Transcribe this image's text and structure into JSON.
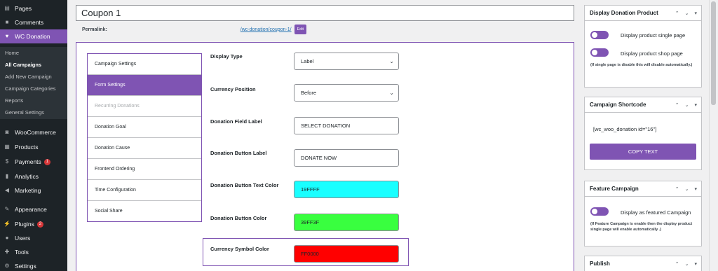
{
  "sidebar": {
    "items": [
      {
        "label": "Pages",
        "icon": "pages-icon"
      },
      {
        "label": "Comments",
        "icon": "comments-icon"
      },
      {
        "label": "WC Donation",
        "icon": "heart-icon"
      },
      {
        "label": "WooCommerce",
        "icon": "woocommerce-icon"
      },
      {
        "label": "Products",
        "icon": "products-icon"
      },
      {
        "label": "Payments",
        "icon": "payments-icon",
        "badge": "1"
      },
      {
        "label": "Analytics",
        "icon": "analytics-icon"
      },
      {
        "label": "Marketing",
        "icon": "marketing-icon"
      },
      {
        "label": "Appearance",
        "icon": "appearance-icon"
      },
      {
        "label": "Plugins",
        "icon": "plugins-icon",
        "badge": "2"
      },
      {
        "label": "Users",
        "icon": "users-icon"
      },
      {
        "label": "Tools",
        "icon": "tools-icon"
      },
      {
        "label": "Settings",
        "icon": "settings-icon"
      }
    ],
    "submenu": [
      "Home",
      "All Campaigns",
      "Add New Campaign",
      "Campaign Categories",
      "Reports",
      "General Settings"
    ]
  },
  "post": {
    "title": "Coupon 1",
    "permalink_label": "Permalink:",
    "permalink_slug_prefix": "/wc-donation/",
    "permalink_slug": "coupon-1",
    "permalink_slug_suffix": "/",
    "edit_label": "Edit"
  },
  "tabs": [
    "Campaign Settings",
    "Form Settings",
    "Recurring Donations",
    "Donation Goal",
    "Donation Cause",
    "Frontend Ordering",
    "Time Configuration",
    "Social Share"
  ],
  "form": {
    "display_type": {
      "label": "Display Type",
      "value": "Label"
    },
    "currency_position": {
      "label": "Currency Position",
      "value": "Before"
    },
    "field_label": {
      "label": "Donation Field Label",
      "value": "SELECT DONATION"
    },
    "button_label": {
      "label": "Donation Button Label",
      "value": "DONATE NOW"
    },
    "button_text_color": {
      "label": "Donation Button Text Color",
      "value": "19FFFF",
      "color": "#19FFFF"
    },
    "button_color": {
      "label": "Donation Button Color",
      "value": "39FF3F",
      "color": "#39FF3F"
    },
    "currency_symbol_color": {
      "label": "Currency Symbol Color",
      "value": "FF0000",
      "color": "#FF0000"
    }
  },
  "boxes": {
    "display_product": {
      "title": "Display Donation Product",
      "opt1": "Display product single page",
      "opt2": "Display product shop page",
      "note": "(If single page is disable this will disable automatically.)"
    },
    "shortcode": {
      "title": "Campaign Shortcode",
      "code": "[wc_woo_donation id=\"16\"]",
      "copy_label": "COPY TEXT"
    },
    "feature": {
      "title": "Feature Campaign",
      "opt1": "Display as featured Campaign",
      "note": "(If Feature Campaign is enable then the display product single page will enable automatically .)"
    },
    "publish": {
      "title": "Publish"
    }
  },
  "colors": {
    "accent": "#7f54b3",
    "admin_bg": "#1d2327"
  }
}
